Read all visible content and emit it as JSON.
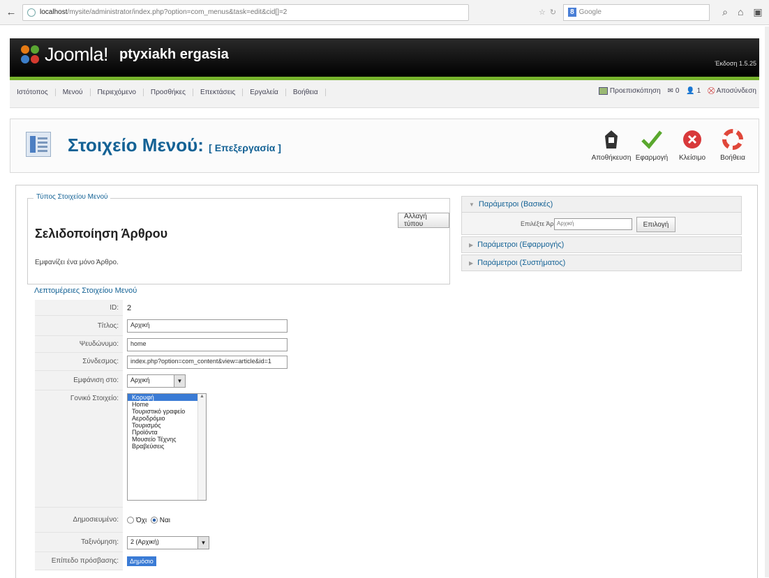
{
  "browser": {
    "url_host": "localhost",
    "url_path": "/mysite/administrator/index.php?option=com_menus&task=edit&cid[]=2",
    "search_engine": "Google"
  },
  "header": {
    "logo_text": "Joomla!",
    "site_name": "ptyxiakh ergasia",
    "version": "Έκδοση 1.5.25"
  },
  "menu": {
    "items": [
      "Ιστότοπος",
      "Μενού",
      "Περιεχόμενο",
      "Προσθήκες",
      "Επεκτάσεις",
      "Εργαλεία",
      "Βοήθεια"
    ],
    "preview_label": "Προεπισκόπηση",
    "messages_count": "0",
    "users_count": "1",
    "logout_label": "Αποσύνδεση"
  },
  "toolbar": {
    "title": "Στοιχείο Μενού:",
    "subtitle": "[ Επεξεργασία ]",
    "save": "Αποθήκευση",
    "apply": "Εφαρμογή",
    "close": "Κλείσιμο",
    "help": "Βοήθεια"
  },
  "type_section": {
    "legend": "Τύπος Στοιχείου Μενού",
    "title": "Σελιδοποίηση Άρθρου",
    "description": "Εμφανίζει ένα μόνο Άρθρο.",
    "change_button": "Αλλαγή τύπου"
  },
  "details": {
    "legend": "Λεπτομέρειες Στοιχείου Μενού",
    "id_label": "ID:",
    "id_value": "2",
    "title_label": "Τίτλος:",
    "title_value": "Αρχική",
    "alias_label": "Ψευδώνυμο:",
    "alias_value": "home",
    "link_label": "Σύνδεσμος:",
    "link_value": "index.php?option=com_content&view=article&id=1",
    "display_label": "Εμφάνιση στο:",
    "display_value": "Αρχική",
    "parent_label": "Γονικό Στοιχείο:",
    "parent_options": [
      "Κορυφή",
      "Home",
      "Τουριστικό γραφείο",
      "Αεροδρόμιο",
      "Τουρισμός",
      "Προϊόντα",
      "Μουσείο Τέχνης",
      "Βραβεύσεις"
    ],
    "published_label": "Δημοσιευμένο:",
    "no_label": "Όχι",
    "yes_label": "Ναι",
    "order_label": "Ταξινόμηση:",
    "order_value": "2 (Αρχική)",
    "access_label": "Επίπεδο πρόσβασης:",
    "access_value": "Δημόσιο"
  },
  "params": {
    "basic": "Παράμετροι (Βασικές)",
    "select_article_label": "Επιλέξτε Άρθρο",
    "select_article_value": "Αρχική",
    "select_button": "Επιλογή",
    "component": "Παράμετροι (Εφαρμογής)",
    "system": "Παράμετροι (Συστήματος)"
  },
  "colors": {
    "accent": "#146295",
    "green_bar": "#76b32c",
    "header_bg": "#000000"
  }
}
